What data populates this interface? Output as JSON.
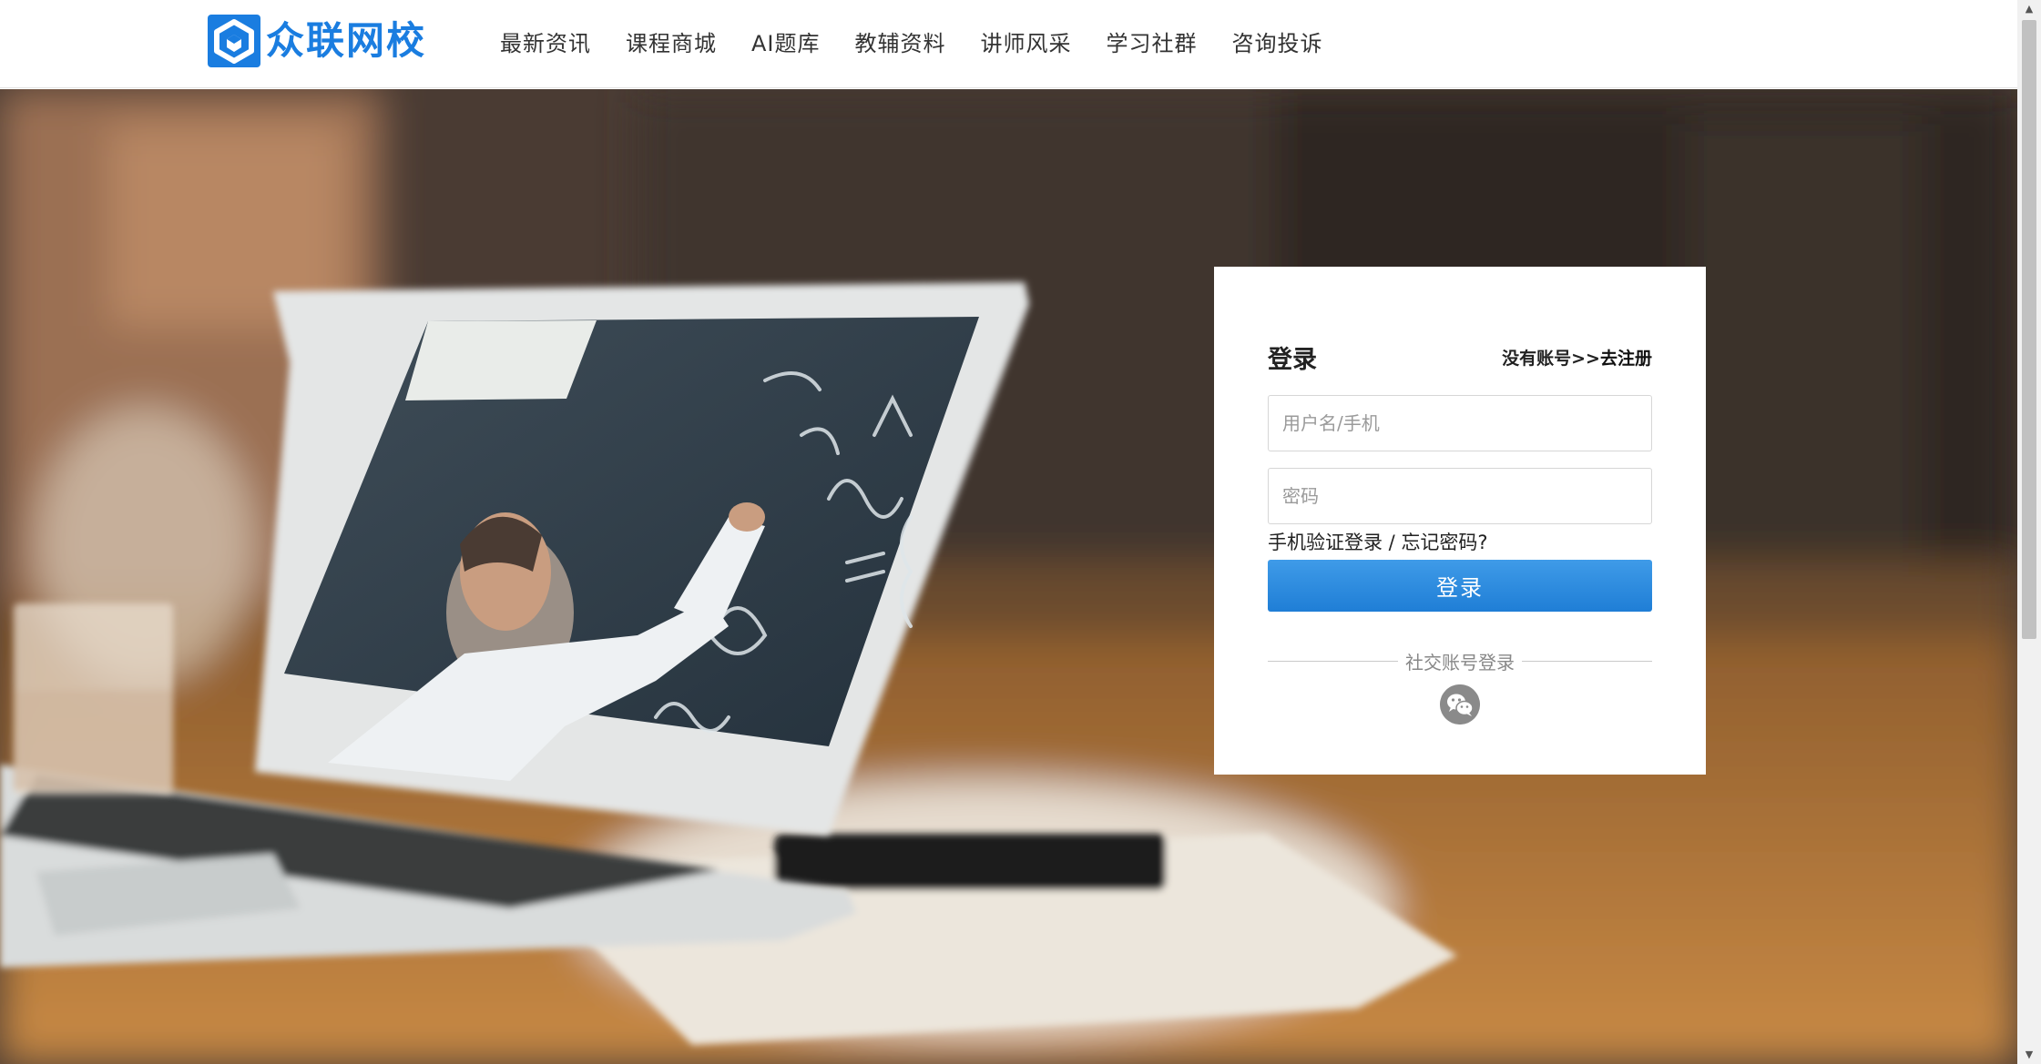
{
  "header": {
    "logo_text": "众联网校",
    "nav": [
      {
        "label": "最新资讯"
      },
      {
        "label": "课程商城"
      },
      {
        "label": "AI题库"
      },
      {
        "label": "教辅资料"
      },
      {
        "label": "讲师风采"
      },
      {
        "label": "学习社群"
      },
      {
        "label": "咨询投诉"
      }
    ]
  },
  "login": {
    "title": "登录",
    "register_prefix": "没有账号>>",
    "register_link": "去注册",
    "username_placeholder": "用户名/手机",
    "password_placeholder": "密码",
    "sms_login": "手机验证登录",
    "separator": " / ",
    "forgot_password": "忘记密码?",
    "submit_label": "登录",
    "social_label": "社交账号登录"
  },
  "colors": {
    "brand": "#1a7de0",
    "button": "#2a8be0"
  },
  "icons": {
    "logo": "cube-logo-icon",
    "social": "wechat-icon",
    "scroll_up": "arrow-up-icon",
    "scroll_down": "arrow-down-icon"
  }
}
